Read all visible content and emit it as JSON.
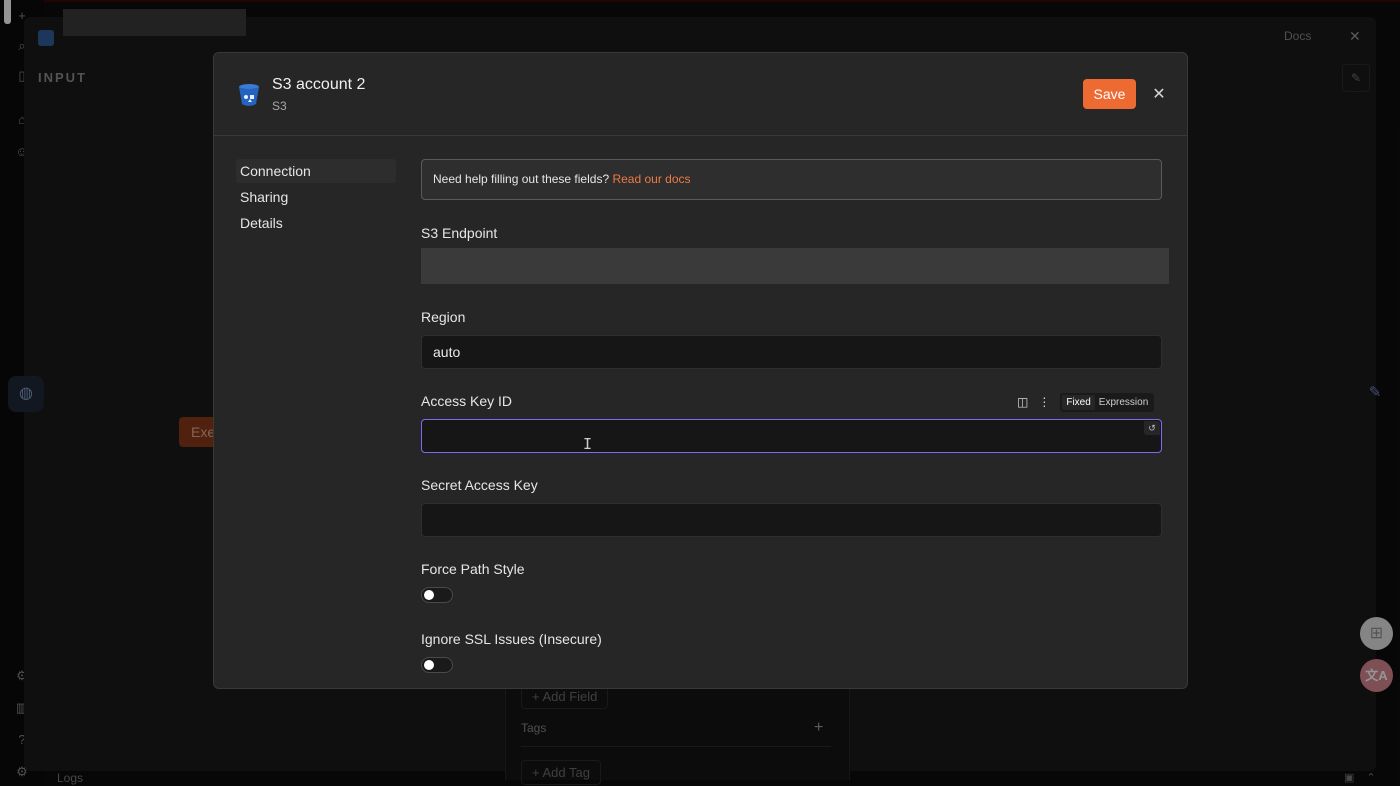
{
  "background": {
    "input_label": "INPUT",
    "docs_label": "Docs",
    "exec_button_label": "Exe",
    "add_field_label": "+ Add Field",
    "tags_label": "Tags",
    "add_tag_label": "+ Add Tag",
    "logs_label": "Logs"
  },
  "modal": {
    "title": "S3 account 2",
    "subtitle": "S3",
    "save_label": "Save",
    "close_glyph": "✕"
  },
  "nav": {
    "items": [
      {
        "label": "Connection"
      },
      {
        "label": "Sharing"
      },
      {
        "label": "Details"
      }
    ]
  },
  "help": {
    "text": "Need help filling out these fields? ",
    "link": "Read our docs"
  },
  "fields": {
    "s3_endpoint": {
      "label": "S3 Endpoint",
      "value": ""
    },
    "region": {
      "label": "Region",
      "value": "auto"
    },
    "access_key_id": {
      "label": "Access Key ID",
      "value": "",
      "mode_fixed": "Fixed",
      "mode_expression": "Expression"
    },
    "secret_access_key": {
      "label": "Secret Access Key",
      "value": ""
    },
    "force_path_style": {
      "label": "Force Path Style",
      "enabled": false
    },
    "ignore_ssl": {
      "label": "Ignore SSL Issues (Insecure)",
      "enabled": false
    }
  },
  "colors": {
    "accent": "#ee6a33",
    "focus": "#7a6cf0",
    "link": "#ee7a45"
  }
}
